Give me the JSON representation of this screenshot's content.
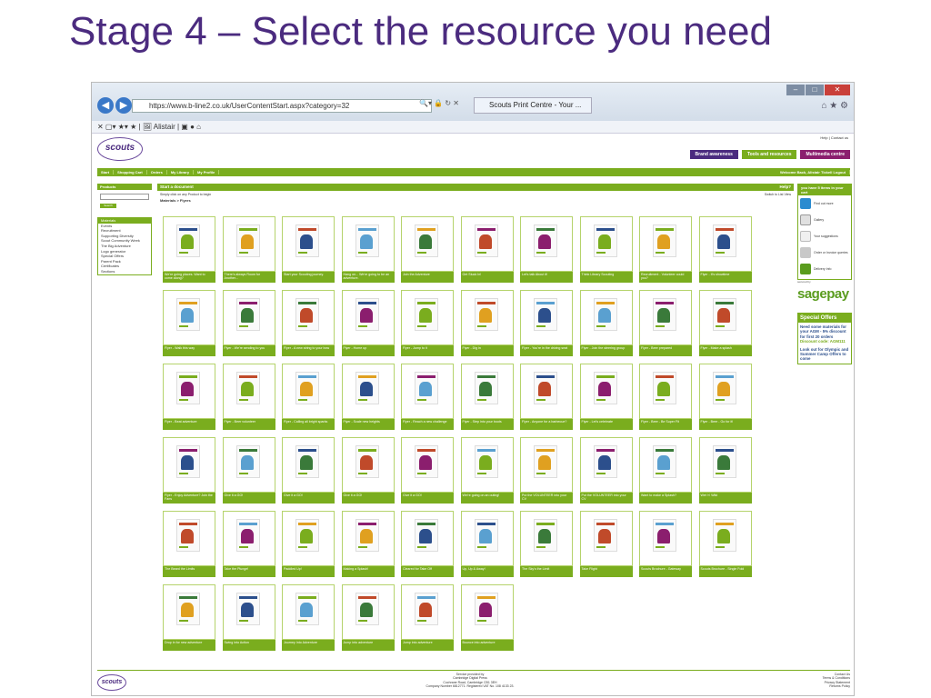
{
  "slide": {
    "title": "Stage 4 – Select the resource you need"
  },
  "browser": {
    "url": "https://www.b-line2.co.uk/UserContentStart.aspx?category=32",
    "tab": "Scouts Print Centre - Your ...",
    "fav_user": "Alistair"
  },
  "site": {
    "logo": "scouts",
    "top_links": "Help | Contact us",
    "brand_tabs": [
      {
        "label": "Brand awareness",
        "color": "#4b2b7f"
      },
      {
        "label": "Tools and resources",
        "color": "#7aad1e"
      },
      {
        "label": "Multimedia centre",
        "color": "#8b1e6e"
      }
    ],
    "nav": [
      "Start",
      "Shopping Cart",
      "Orders",
      "My Library",
      "My Profile"
    ],
    "welcome": "Welcome Back, Alistair Tickell   Logout",
    "products_head": "Products",
    "search_btn": "Search",
    "categories": [
      "Materials",
      "Events",
      "Recruitment",
      "Supporting Diversity",
      "Scout Community Week",
      "The Big Adventure",
      "Logo generator",
      "Special Offers",
      "Parent Pack",
      "Certificates",
      "Sections"
    ],
    "main_head": "Start a document",
    "main_help": "Help?",
    "instructions": "Simply click on any Product to begin",
    "instructions_right": "Switch to List View",
    "breadcrumb": "Materials > Flyers",
    "help_head": "you have 5 items in your cart",
    "help_items": [
      "Find out more",
      "Gallery",
      "Your suggestions",
      "Order or Invoice queries",
      "Delivery Info"
    ],
    "secured": "secured by",
    "sagepay": "sagepay",
    "offers_head": "Special Offers",
    "offers_text": "Need some materials for your AGM - 5% discount for first 20 orders",
    "offers_code": "Discount code: AGM111",
    "offers_text2": "Look out for Olympic and Summer Camp Offers to come",
    "footer_center": [
      "Service provided by",
      "Cambridge Digital Press",
      "Cochrane Road, Cambridge CB1 3EH",
      "Company Number 6812771. Registered VAT No. 108 4133 23."
    ],
    "footer_right": [
      "Contact Us",
      "Terms & Conditions",
      "Privacy Statement",
      "Returns Policy"
    ]
  },
  "products": [
    "We're going places. Want to come along?",
    "There's always Room for Another...",
    "Start your Scouting journey.",
    "Hang on... We're going to be an adventure.",
    "Join the Adventure",
    "Get Stuck In!",
    "Let's talk About it!",
    "Think Library Scouting",
    "Recruitment - Volunteer could you?",
    "Flyer - It's showtime",
    "Flyer - Walk this way",
    "Flyer - We're sending to you",
    "Flyer - A new string to your bow",
    "Flyer - Home up",
    "Flyer - Jump to it",
    "Flyer - Dig in",
    "Flyer - You're in the driving seat",
    "Flyer - Join the steering group",
    "Flyer - Beer prepared",
    "Flyer - Make a splash",
    "Flyer - Beat adventure",
    "Flyer - Beer volunteer",
    "Flyer - Calling all bright sparks",
    "Flyer - Scale new heights",
    "Flyer - Reach a new challenge",
    "Flyer - Step into your boots",
    "Flyer - Anyone for a barbecue?",
    "Flyer - Let's celebrate",
    "Flyer - Beer - Be Super Fit",
    "Flyer - Beer - Go for it!",
    "Flyer - Enjoy Adventure? Join the Fans",
    "Give it a GO!",
    "Give it a GO!",
    "Give it a GO!",
    "Give it a GO!",
    "We're going on an outing!",
    "Put the VOLUNTEER into your CV",
    "Put the VOLUNTEER into your CV",
    "Want to make a Splash?",
    "Wet 'n' Wild",
    "The Beard the Limits",
    "Take the Plunge!",
    "Paddled Up!",
    "Making a Splash!",
    "Cleared for Take Off",
    "Up, Up & Away!",
    "The Sky's the Limit",
    "Take Flight",
    "Scouts Brochure - Gateway",
    "Scouts Brochure - Single Fold",
    "Drop in for new adventure",
    "Swing into Action",
    "Journey Into Adventure",
    "Jump into adventure",
    "Jump into adventure",
    "Bounce into adventure"
  ],
  "colors": {
    "accent": "#7aad1e",
    "brand": "#4b2b7f",
    "title": "#4b2b7f"
  }
}
